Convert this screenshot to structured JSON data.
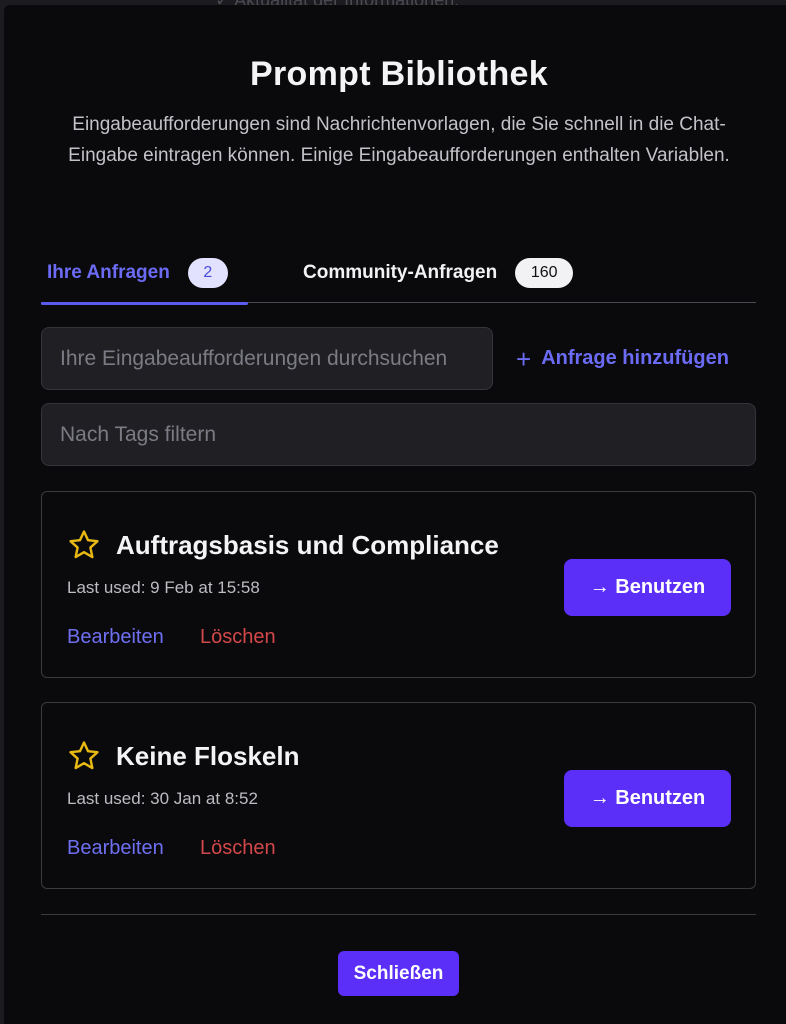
{
  "backdrop": {
    "text": "✓ Aktualität der Informationen:"
  },
  "modal": {
    "title": "Prompt Bibliothek",
    "description": "Eingabeaufforderungen sind Nachrichtenvorlagen, die Sie schnell in die Chat-Eingabe eintragen können. Einige Eingabeaufforderungen enthalten Variablen."
  },
  "tabs": [
    {
      "label": "Ihre Anfragen",
      "count": "2",
      "active": true
    },
    {
      "label": "Community-Anfragen",
      "count": "160",
      "active": false
    }
  ],
  "search": {
    "placeholder": "Ihre Eingabeaufforderungen durchsuchen",
    "value": ""
  },
  "add_button": {
    "icon": "plus-icon",
    "label": "Anfrage hinzufügen"
  },
  "tag_filter": {
    "placeholder": "Nach Tags filtern",
    "value": ""
  },
  "prompts": [
    {
      "title": "Auftragsbasis und Compliance",
      "last_used": "Last used: 9 Feb at 15:58",
      "edit_label": "Bearbeiten",
      "delete_label": "Löschen",
      "use_label": "→ Benutzen",
      "icon": "star-icon"
    },
    {
      "title": "Keine Floskeln",
      "last_used": "Last used: 30 Jan at 8:52",
      "edit_label": "Bearbeiten",
      "delete_label": "Löschen",
      "use_label": "→ Benutzen",
      "icon": "star-icon"
    }
  ],
  "footer": {
    "close_label": "Schließen"
  },
  "colors": {
    "accent": "#5b2ff7",
    "link": "#6f6ff2",
    "danger": "#d2484a",
    "star": "#e8b912",
    "background": "#0a0a0c"
  }
}
